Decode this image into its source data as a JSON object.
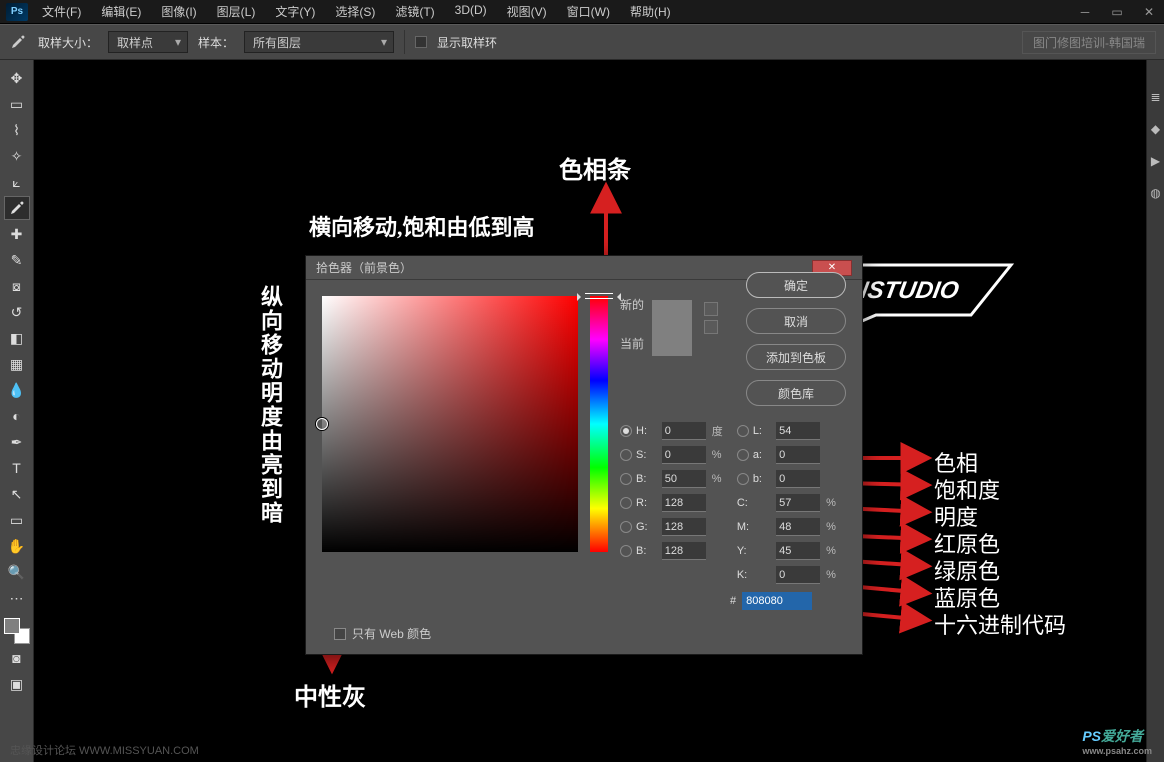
{
  "titlebar": {
    "logo": "Ps"
  },
  "menu": [
    "文件(F)",
    "编辑(E)",
    "图像(I)",
    "图层(L)",
    "文字(Y)",
    "选择(S)",
    "滤镜(T)",
    "3D(D)",
    "视图(V)",
    "窗口(W)",
    "帮助(H)"
  ],
  "optbar": {
    "sample_size_label": "取样大小：",
    "sample_size_value": "取样点",
    "sample_label": "样本：",
    "sample_value": "所有图层",
    "show_ring": "显示取样环",
    "right_text": "图门修图培训-韩国瑞"
  },
  "tools": [
    "↔",
    "▭",
    "◯",
    "✦",
    "✂",
    "⇱",
    "✎",
    "⬚",
    "✐",
    "⧉",
    "⌫",
    "▤",
    "●",
    "◉",
    "✎",
    "T",
    "↖",
    "⬡",
    "✋",
    "🔍",
    "⋯"
  ],
  "picker": {
    "title": "拾色器（前景色）",
    "ok": "确定",
    "cancel": "取消",
    "add": "添加到色板",
    "lib": "颜色库",
    "new": "新的",
    "current": "当前",
    "H": {
      "l": "H:",
      "v": "0",
      "u": "度"
    },
    "S": {
      "l": "S:",
      "v": "0",
      "u": "%"
    },
    "Bv": {
      "l": "B:",
      "v": "50",
      "u": "%"
    },
    "R": {
      "l": "R:",
      "v": "128"
    },
    "G": {
      "l": "G:",
      "v": "128"
    },
    "Bc": {
      "l": "B:",
      "v": "128"
    },
    "L": {
      "l": "L:",
      "v": "54"
    },
    "a": {
      "l": "a:",
      "v": "0"
    },
    "b": {
      "l": "b:",
      "v": "0"
    },
    "C": {
      "l": "C:",
      "v": "57",
      "u": "%"
    },
    "M": {
      "l": "M:",
      "v": "48",
      "u": "%"
    },
    "Y": {
      "l": "Y:",
      "v": "45",
      "u": "%"
    },
    "K": {
      "l": "K:",
      "v": "0",
      "u": "%"
    },
    "hex": "808080",
    "web": "只有 Web 颜色"
  },
  "anno": {
    "hue_bar": "色相条",
    "horiz": "横向移动,饱和由低到高",
    "vert": "纵向移动明度由亮到暗",
    "neutral": "中性灰",
    "labels": [
      "色相",
      "饱和度",
      "明度",
      "红原色",
      "绿原色",
      "蓝原色",
      "十六进制代码"
    ]
  },
  "watermark": {
    "left": "忠缘设计论坛  WWW.MISSYUAN.COM",
    "right_ps": "PS",
    "right_txt": "爱好者",
    "url": "www.psahz.com"
  }
}
